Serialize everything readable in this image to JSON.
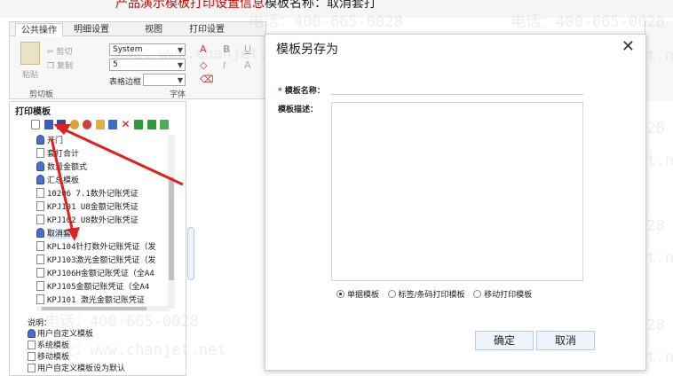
{
  "banner": {
    "lead": "产品演示模板",
    "highlight": "打印设置信息",
    "tail": "模板名称：取消套打"
  },
  "ribbon": {
    "tabs": [
      "公共操作",
      "明细设置",
      "视图",
      "打印设置"
    ],
    "active_tab": 0,
    "paste_label": "粘贴",
    "cut_label": "剪切",
    "copy_label": "复制",
    "clipboard_group": "剪切板",
    "font_name": "System",
    "font_size": "5",
    "table_border_label": "表格边框",
    "font_group": "字体"
  },
  "left_panel": {
    "title": "打印模板",
    "items": [
      {
        "label": "开门",
        "icon": "user"
      },
      {
        "label": "套打合计",
        "icon": "doc"
      },
      {
        "label": "数量金额式",
        "icon": "user"
      },
      {
        "label": "汇总模板",
        "icon": "user"
      },
      {
        "label": "10206 7.1数外记账凭证",
        "icon": "doc"
      },
      {
        "label": "KPJ101 U8金额记账凭证",
        "icon": "doc"
      },
      {
        "label": "KPJ102 U8数外记账凭证",
        "icon": "doc"
      },
      {
        "label": "取消套打",
        "icon": "user",
        "selected": true
      },
      {
        "label": "KPL104针打数外记账凭证（发",
        "icon": "doc"
      },
      {
        "label": "KPJ103激光金额记账凭证（发",
        "icon": "doc"
      },
      {
        "label": "KPJ106H金额记账凭证（全A4",
        "icon": "doc"
      },
      {
        "label": "KPJ105金额记账凭证（全A4",
        "icon": "doc"
      },
      {
        "label": "KPJ101 激光金额记账凭证",
        "icon": "doc"
      }
    ],
    "desc_label": "说明：",
    "legend": [
      {
        "label": "用户自定义模板",
        "icon": "user"
      },
      {
        "label": "系统模板",
        "icon": "doc"
      },
      {
        "label": "移动模板",
        "icon": "doc"
      },
      {
        "label": "用户自定义模板设为默认",
        "icon": "doc"
      }
    ]
  },
  "watermark": {
    "phone": "电话：400-665-0028",
    "site": "网址：www.chanjet.net"
  },
  "dialog": {
    "title": "模板另存为",
    "close": "✕",
    "required_mark": "*",
    "name_label": "模板名称：",
    "name_value": "",
    "desc_label": "模板描述：",
    "desc_value": "",
    "radio_options": [
      "单据模板",
      "标签/条码打印模板",
      "移动打印模板"
    ],
    "radio_selected": 0,
    "ok_label": "确定",
    "cancel_label": "取消"
  },
  "colors": {
    "accent_red": "#e02020",
    "button_bg": "#eef4fc",
    "button_border": "#b8cbe8"
  }
}
